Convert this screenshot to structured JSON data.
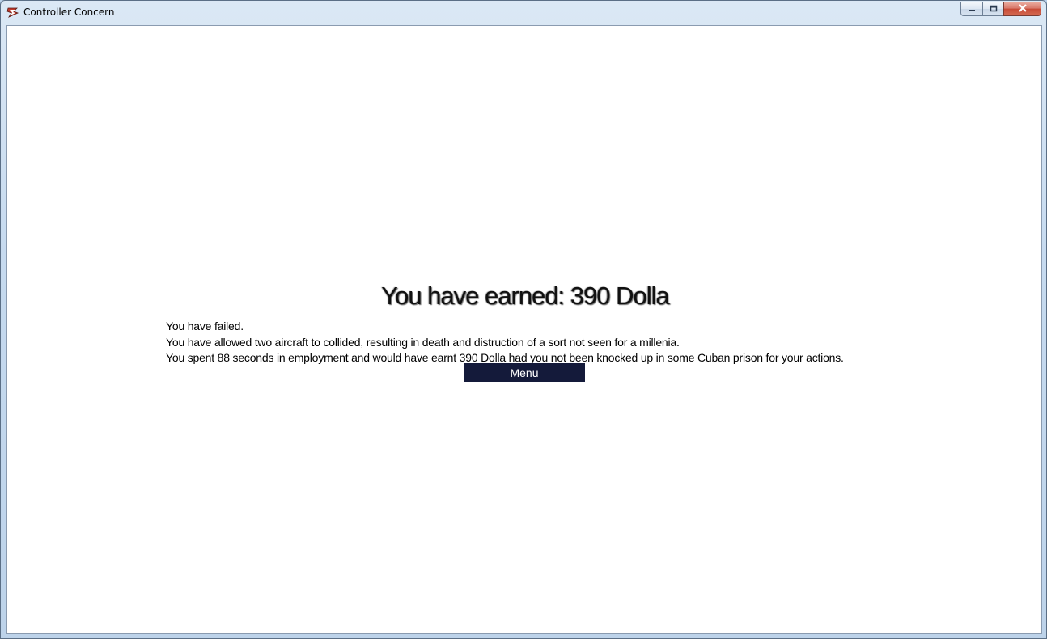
{
  "window": {
    "title": "Controller Concern",
    "icon": "app-icon"
  },
  "caption": {
    "minimize_icon": "minimize-icon",
    "maximize_icon": "maximize-icon",
    "close_icon": "close-icon"
  },
  "screen": {
    "earned_title": "You have earned: 390 Dolla",
    "lines": [
      "You have failed.",
      "You have allowed two aircraft to collided, resulting in death and distruction of a sort not seen for a millenia.",
      "You spent 88 seconds in employment and would have earnt 390 Dolla had you not been knocked up in some Cuban prison for your actions."
    ],
    "menu_label": "Menu"
  },
  "colors": {
    "menu_button_bg": "#141a3a",
    "menu_button_text": "#ffffff",
    "client_bg": "#ffffff"
  }
}
